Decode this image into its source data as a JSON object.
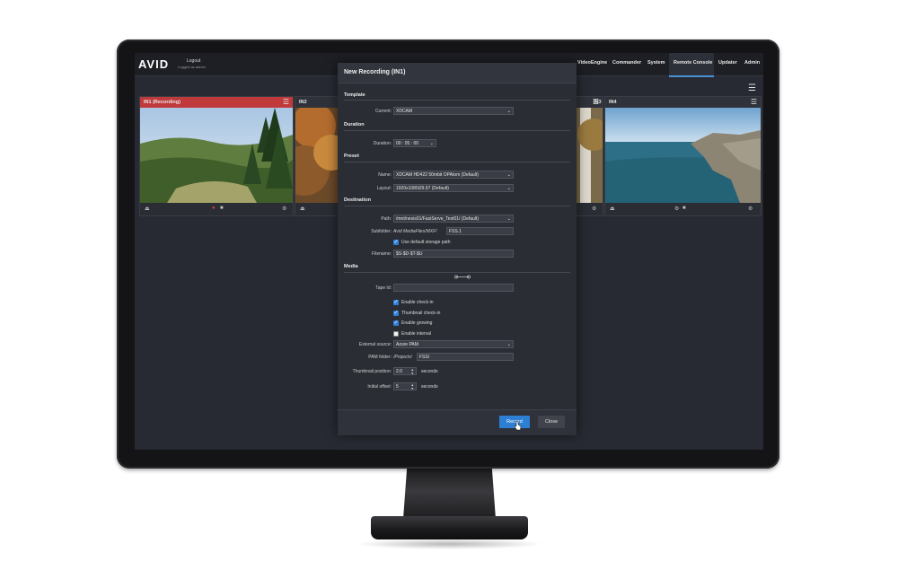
{
  "app": {
    "logo": "AVID",
    "logout": "Logout",
    "logged_in_as": "Logged as admin",
    "nav": [
      "VideoEngine",
      "Commander",
      "System",
      "Remote Console",
      "Updater",
      "Admin"
    ],
    "active_nav": "Remote Console"
  },
  "channels": [
    {
      "name": "IN1 (Recording)",
      "status": "recording",
      "accent": "#c0393b"
    },
    {
      "name": "IN2",
      "status": "idle"
    },
    {
      "name": "IN3",
      "status": "idle"
    },
    {
      "name": "IN4",
      "status": "idle"
    }
  ],
  "dialog": {
    "title": "New Recording (IN1)",
    "template": {
      "section": "Template",
      "current_label": "Current:",
      "current_value": "XDCAM"
    },
    "duration": {
      "section": "Duration",
      "label": "Duration:",
      "value": "00 : 05 : 00"
    },
    "preset": {
      "section": "Preset",
      "name_label": "Name:",
      "name_value": "XDCAM HD422 50mbit OPAtom (Default)",
      "layout_label": "Layout:",
      "layout_value": "1920x1080i29.97 (Default)"
    },
    "destination": {
      "section": "Destination",
      "path_label": "Path:",
      "path_value": "/mnt/nexis01/FastServe_Test01/ (Default)",
      "subfolder_label": "Subfolder:",
      "subfolder_prefix": "Avid MediaFiles/MXF/",
      "subfolder_value": "FSS.1",
      "default_storage_label": "Use default storage path",
      "default_storage_checked": true,
      "filename_label": "Filename:",
      "filename_value": "$S-$D-$T-$U"
    },
    "media": {
      "section": "Media",
      "tape_id_label": "Tape Id:",
      "tape_id_value": "",
      "checkboxes": [
        {
          "label": "Enable check-in",
          "checked": true
        },
        {
          "label": "Thumbnail check-in",
          "checked": true
        },
        {
          "label": "Enable growing",
          "checked": true
        },
        {
          "label": "Enable interval",
          "checked": false
        }
      ],
      "external_source_label": "External source:",
      "external_source_value": "Azure PAM",
      "pam_folder_label": "PAM folder:",
      "pam_folder_prefix": "/Projects/",
      "pam_folder_value": "FSS/",
      "thumb_pos_label": "Thumbnail position:",
      "thumb_pos_value": "2.0",
      "thumb_pos_unit": "seconds",
      "initial_offset_label": "Initial offset:",
      "initial_offset_value": "5",
      "initial_offset_unit": "seconds"
    },
    "buttons": {
      "record": "Record",
      "close": "Close"
    }
  },
  "colors": {
    "accent": "#2d7fd4",
    "recording": "#c0393b",
    "screen_bg": "#272a32"
  }
}
